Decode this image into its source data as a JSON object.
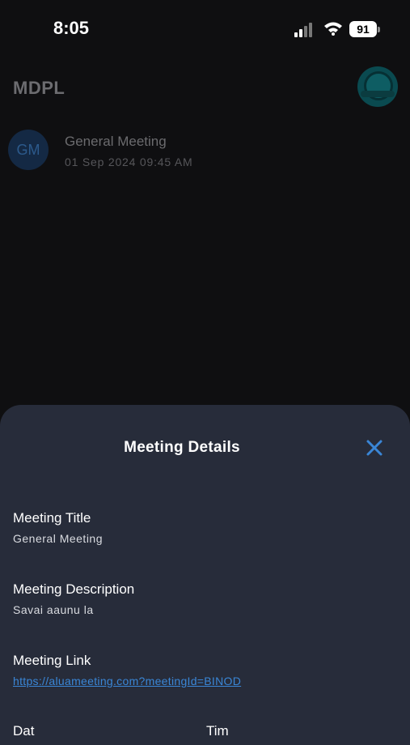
{
  "status_bar": {
    "time": "8:05",
    "battery": "91"
  },
  "header": {
    "app_title": "MDPL"
  },
  "meetings": [
    {
      "initials": "GM",
      "title": "General Meeting",
      "datetime": "01 Sep 2024  09:45 AM"
    }
  ],
  "sheet": {
    "title": "Meeting Details",
    "fields": [
      {
        "label": "Meeting Title",
        "value": "General Meeting"
      },
      {
        "label": "Meeting Description",
        "value": "Savai aaunu la"
      },
      {
        "label": "Meeting Link",
        "value": "https://aluameeting.com?meetingId=BINOD"
      }
    ],
    "partial_labels": [
      "Dat",
      "Tim"
    ]
  },
  "colors": {
    "accent": "#3a86d6",
    "sheet_bg": "#272c3a",
    "page_bg": "#0f0f11"
  },
  "icons": [
    "cellular-signal-icon",
    "wifi-icon",
    "battery-icon",
    "close-icon"
  ]
}
